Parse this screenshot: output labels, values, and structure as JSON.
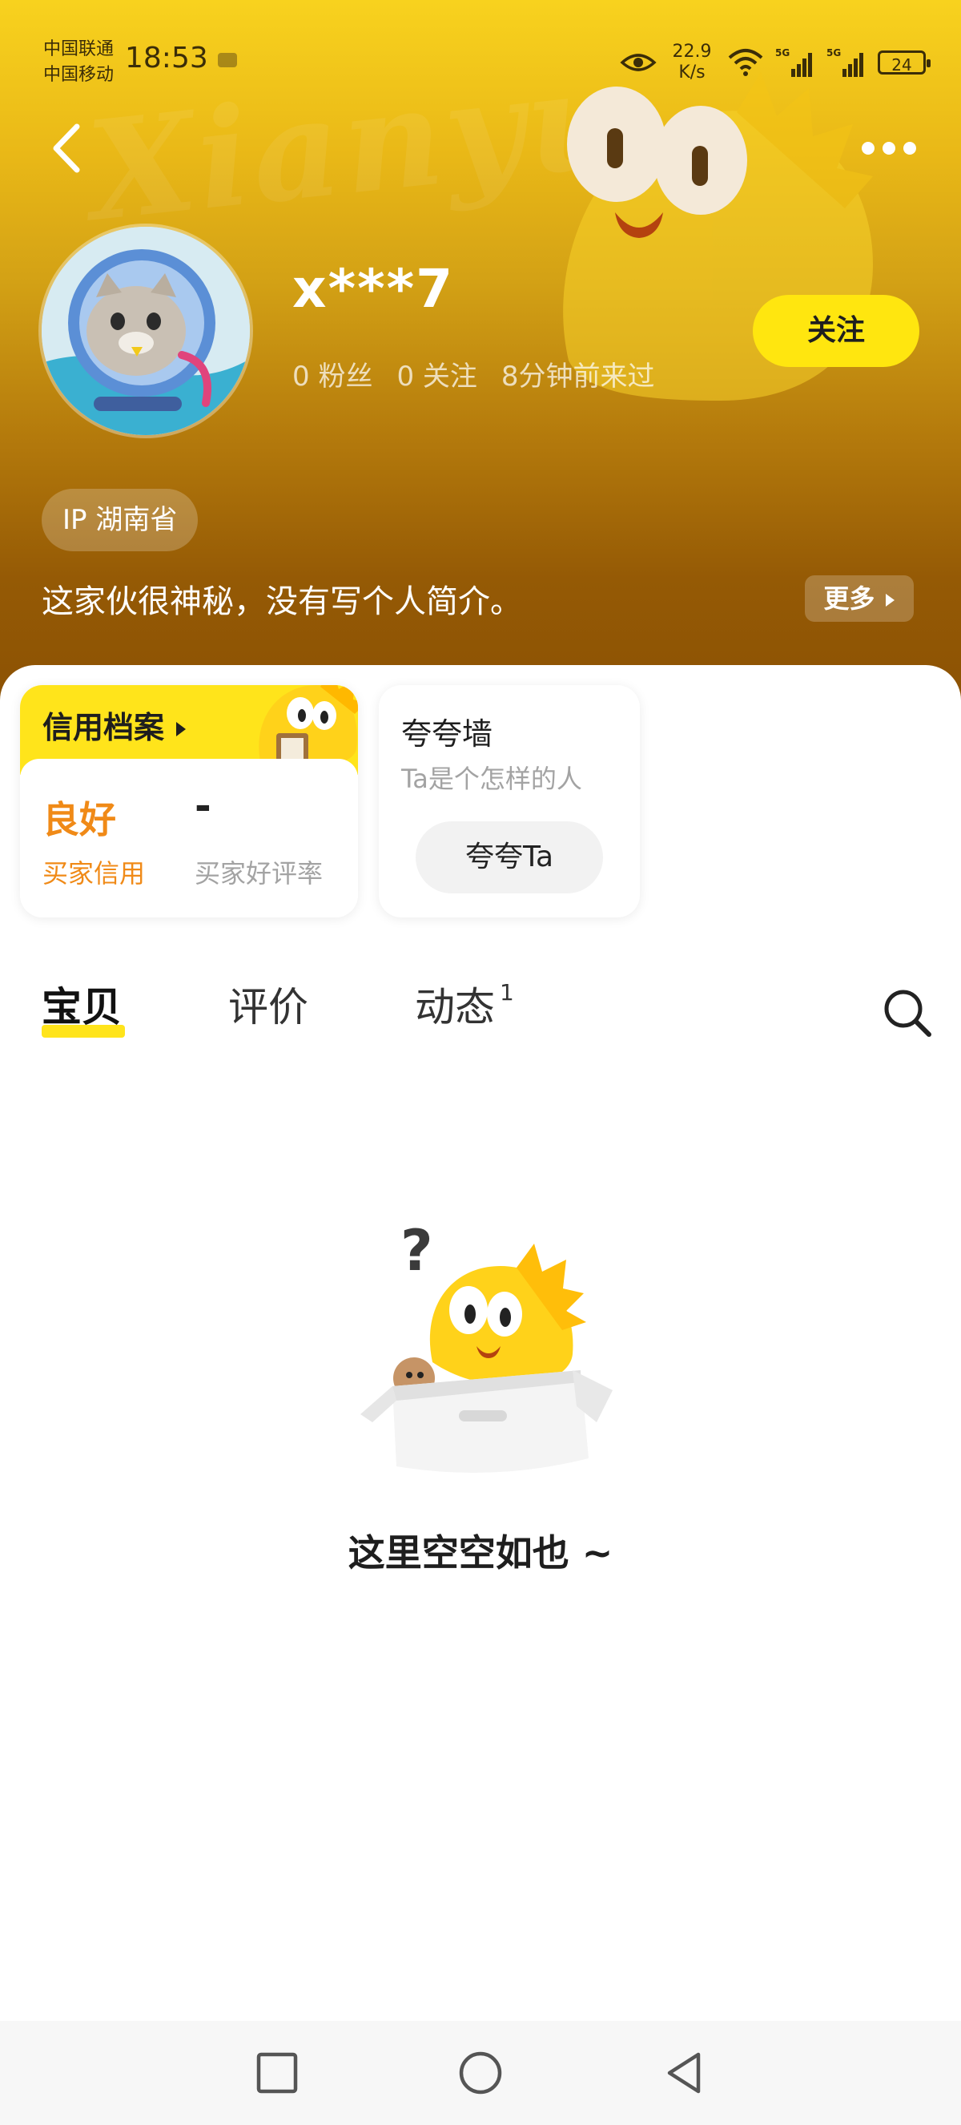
{
  "status_bar": {
    "carrier_1": "中国联通",
    "carrier_2": "中国移动",
    "time": "18:53",
    "net_speed_value": "22.9",
    "net_speed_unit": "K/s",
    "battery": "24"
  },
  "profile": {
    "username": "x***7",
    "followers_count": "0",
    "followers_label": "粉丝",
    "following_count": "0",
    "following_label": "关注",
    "last_active": "8分钟前来过",
    "follow_button": "关注",
    "ip_location": "IP 湖南省",
    "bio": "这家伙很神秘，没有写个人简介。",
    "more_button": "更多"
  },
  "credit_card": {
    "title": "信用档案",
    "buyer_credit_value": "良好",
    "buyer_credit_label": "买家信用",
    "buyer_rating_value": "-",
    "buyer_rating_label": "买家好评率"
  },
  "praise_card": {
    "title": "夸夸墙",
    "subtitle": "Ta是个怎样的人",
    "button": "夸夸Ta"
  },
  "tabs": [
    {
      "label": "宝贝",
      "active": true
    },
    {
      "label": "评价",
      "active": false
    },
    {
      "label": "动态",
      "badge": "1",
      "active": false
    }
  ],
  "empty_state": {
    "text": "这里空空如也 ~"
  },
  "colors": {
    "accent_yellow": "#ffe41b",
    "credit_orange": "#f08a17",
    "header_top": "#f8d21e",
    "header_bottom": "#8c5204"
  },
  "icons": {
    "back": "chevron-left-icon",
    "more": "more-dots-icon",
    "search": "search-icon",
    "nav_recent": "square-icon",
    "nav_home": "circle-icon",
    "nav_back": "triangle-back-icon"
  }
}
